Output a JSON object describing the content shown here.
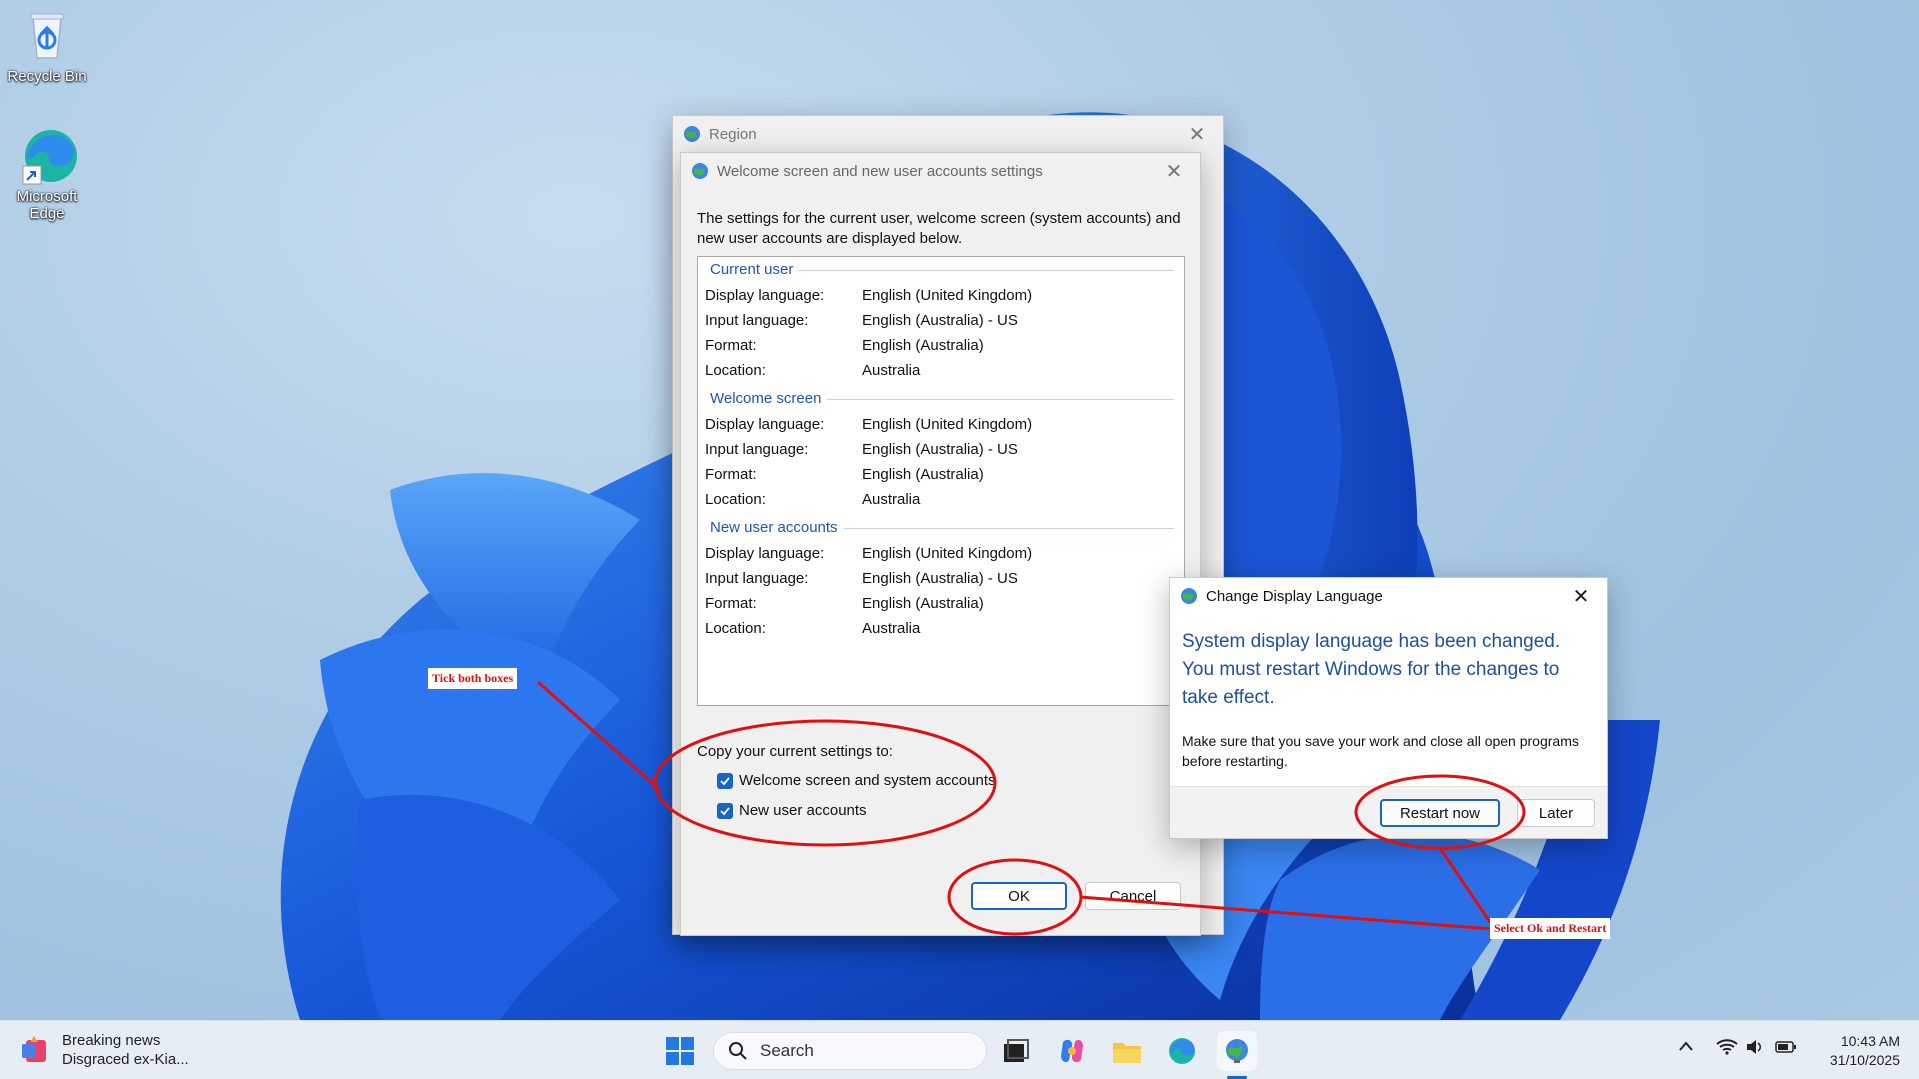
{
  "desktop": {
    "icons": [
      {
        "label": "Recycle Bin",
        "icon": "recycle-bin-icon"
      },
      {
        "label": "Microsoft Edge",
        "icon": "edge-icon"
      }
    ]
  },
  "region_window": {
    "title": "Region"
  },
  "welcome_window": {
    "title": "Welcome screen and new user accounts settings",
    "intro": "The settings for the current user, welcome screen (system accounts) and new user accounts are displayed below.",
    "sections": [
      {
        "heading": "Current user",
        "rows": [
          {
            "label": "Display language:",
            "value": "English (United Kingdom)"
          },
          {
            "label": "Input language:",
            "value": "English (Australia) - US"
          },
          {
            "label": "Format:",
            "value": "English (Australia)"
          },
          {
            "label": "Location:",
            "value": "Australia"
          }
        ]
      },
      {
        "heading": "Welcome screen",
        "rows": [
          {
            "label": "Display language:",
            "value": "English (United Kingdom)"
          },
          {
            "label": "Input language:",
            "value": "English (Australia) - US"
          },
          {
            "label": "Format:",
            "value": "English (Australia)"
          },
          {
            "label": "Location:",
            "value": "Australia"
          }
        ]
      },
      {
        "heading": "New user accounts",
        "rows": [
          {
            "label": "Display language:",
            "value": "English (United Kingdom)"
          },
          {
            "label": "Input language:",
            "value": "English (Australia) - US"
          },
          {
            "label": "Format:",
            "value": "English (Australia)"
          },
          {
            "label": "Location:",
            "value": "Australia"
          }
        ]
      }
    ],
    "copy_label": "Copy your current settings to:",
    "checkboxes": [
      {
        "label": "Welcome screen and system accounts",
        "checked": true
      },
      {
        "label": "New user accounts",
        "checked": true
      }
    ],
    "ok_label": "OK",
    "cancel_label": "Cancel"
  },
  "change_window": {
    "title": "Change Display Language",
    "message": "System display language has been changed. You must restart Windows for the changes to take effect.",
    "note": "Make sure that you save your work and close all open programs before restarting.",
    "restart_label": "Restart now",
    "later_label": "Later"
  },
  "annotations": {
    "tick_note": "Tick both boxes",
    "select_note": "Select Ok and Restart",
    "color": "#e01010"
  },
  "taskbar": {
    "news_title": "Breaking news",
    "news_sub": "Disgraced ex-Kia...",
    "search_placeholder": "Search",
    "time": "10:43 AM",
    "date": "31/10/2025"
  }
}
